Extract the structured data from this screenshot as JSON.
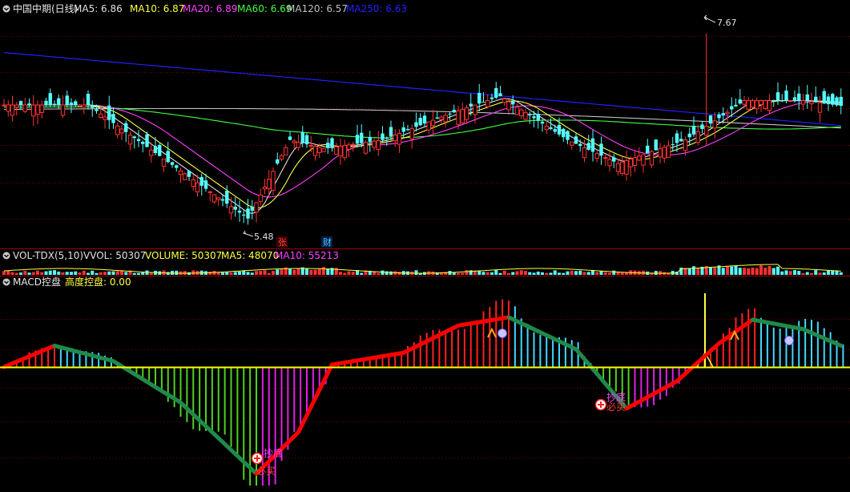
{
  "main_panel": {
    "title": "中国中期(日线)",
    "ma_labels": [
      {
        "text": "MA5: 6.86",
        "color": "#e0e0e0"
      },
      {
        "text": "MA10: 6.87",
        "color": "#ffff40"
      },
      {
        "text": "MA20: 6.89",
        "color": "#ff40ff"
      },
      {
        "text": "MA60: 6.69",
        "color": "#40ff40"
      },
      {
        "text": "MA120: 6.57",
        "color": "#c0c0c0"
      },
      {
        "text": "MA250: 6.63",
        "color": "#2020ff"
      }
    ],
    "high_marker": "7.67",
    "low_marker": "5.48",
    "event_labels": [
      "张",
      "财"
    ]
  },
  "volume_panel": {
    "labels": [
      {
        "text": "VOL-TDX(5,10)",
        "color": "#e0e0e0"
      },
      {
        "text": "VVOL: 50307",
        "color": "#e0e0e0"
      },
      {
        "text": "VOLUME: 50307",
        "color": "#ffff40"
      },
      {
        "text": "MA5: 48070",
        "color": "#ffff40"
      },
      {
        "text": "MA10: 55213",
        "color": "#ff40ff"
      }
    ]
  },
  "macd_panel": {
    "title": "MACD控盘",
    "subtitle": "高度控盘: 0.00",
    "signals": [
      {
        "top": "抄底",
        "bottom": "必买"
      },
      {
        "top": "抄底",
        "bottom": "必买"
      }
    ]
  },
  "colors": {
    "up": "#ff3232",
    "down": "#54ffff",
    "grid": "#7a0000",
    "ma5": "#e0e0e0",
    "ma10": "#ffff40",
    "ma20": "#ff40ff",
    "ma60": "#40ff40",
    "ma120": "#c0c0c0",
    "ma250": "#2020ff",
    "zero_line": "#ffff00",
    "macd_up": "#ff0000",
    "macd_down": "#1f8a4a",
    "hist_red": "#ff2020",
    "hist_cyan": "#40d8ff",
    "hist_green": "#50d020",
    "hist_magenta": "#e020e0"
  },
  "chart_data": [
    {
      "type": "candlestick",
      "title": "中国中期(日线)",
      "ylim": [
        5.3,
        7.85
      ],
      "annotations": [
        {
          "label": "7.67",
          "value": 7.67
        },
        {
          "label": "5.48",
          "value": 5.48
        }
      ],
      "key_points": [
        {
          "i": 0,
          "close": 6.85
        },
        {
          "i": 20,
          "close": 6.85
        },
        {
          "i": 36,
          "close": 6.3
        },
        {
          "i": 58,
          "close": 5.55
        },
        {
          "i": 68,
          "close": 6.45
        },
        {
          "i": 76,
          "close": 6.35
        },
        {
          "i": 90,
          "close": 6.45
        },
        {
          "i": 106,
          "close": 6.75
        },
        {
          "i": 118,
          "close": 6.95
        },
        {
          "i": 134,
          "close": 6.45
        },
        {
          "i": 146,
          "close": 6.18
        },
        {
          "i": 162,
          "close": 6.45
        },
        {
          "i": 170,
          "close": 6.7
        },
        {
          "i": 176,
          "close": 6.9
        },
        {
          "i": 190,
          "close": 6.9
        },
        {
          "i": 199,
          "close": 6.84
        }
      ]
    },
    {
      "type": "bar",
      "title": "VOL-TDX(5,10)",
      "latest": {
        "VVOL": 50307,
        "VOLUME": 50307,
        "MA5": 48070,
        "MA10": 55213
      }
    },
    {
      "type": "line",
      "title": "MACD控盘",
      "ylim": [
        -1.0,
        0.65
      ],
      "key_points": [
        {
          "i": 0,
          "v": 0.0
        },
        {
          "i": 12,
          "v": 0.18
        },
        {
          "i": 26,
          "v": 0.05
        },
        {
          "i": 42,
          "v": -0.3
        },
        {
          "i": 60,
          "v": -0.9
        },
        {
          "i": 70,
          "v": -0.55
        },
        {
          "i": 78,
          "v": 0.02
        },
        {
          "i": 95,
          "v": 0.12
        },
        {
          "i": 108,
          "v": 0.35
        },
        {
          "i": 120,
          "v": 0.42
        },
        {
          "i": 136,
          "v": 0.15
        },
        {
          "i": 148,
          "v": -0.35
        },
        {
          "i": 160,
          "v": -0.12
        },
        {
          "i": 170,
          "v": 0.2
        },
        {
          "i": 178,
          "v": 0.4
        },
        {
          "i": 190,
          "v": 0.32
        },
        {
          "i": 199,
          "v": 0.18
        }
      ]
    }
  ]
}
